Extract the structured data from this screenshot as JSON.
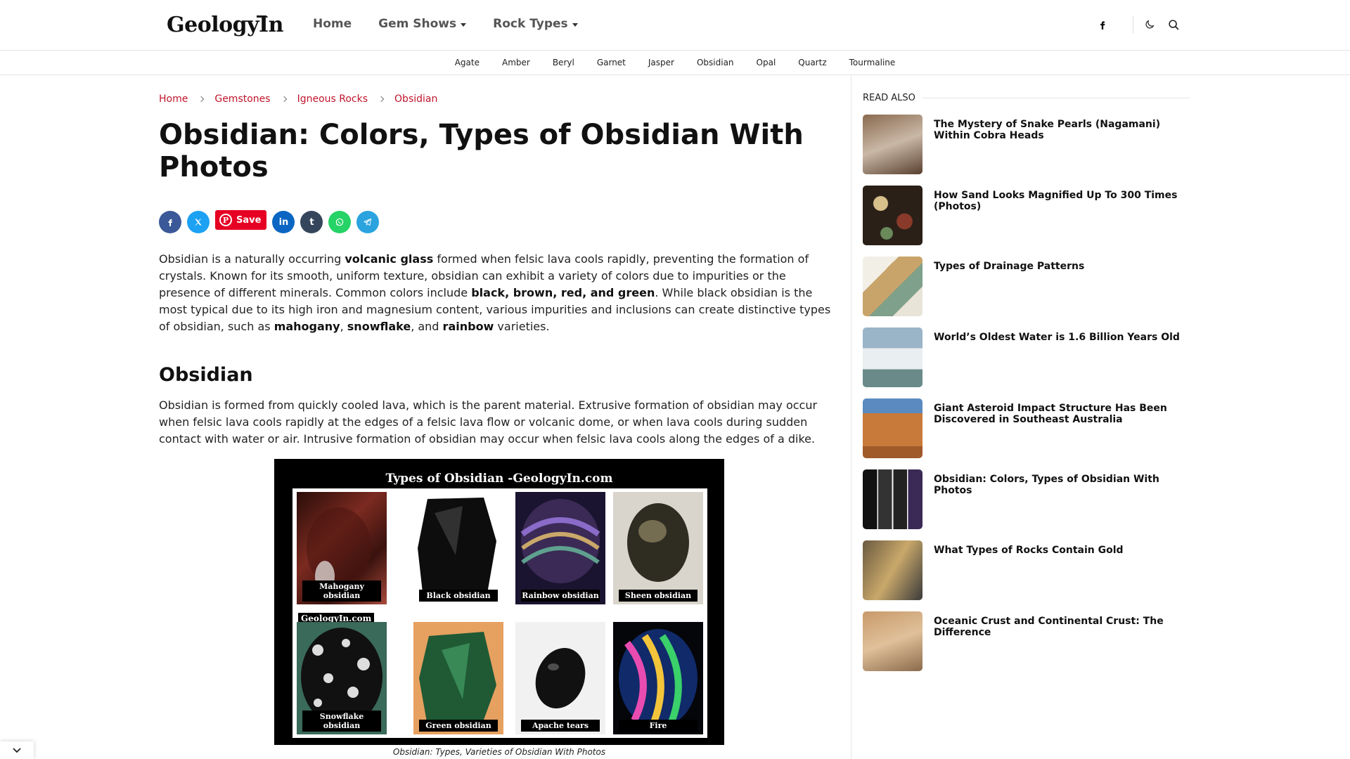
{
  "header": {
    "logo": "GeologyIn",
    "nav": [
      {
        "label": "Home",
        "dropdown": false
      },
      {
        "label": "Gem Shows",
        "dropdown": true
      },
      {
        "label": "Rock Types",
        "dropdown": true
      }
    ],
    "icons": [
      "facebook-icon",
      "dark-mode-icon",
      "search-icon"
    ]
  },
  "subnav": [
    "Agate",
    "Amber",
    "Beryl",
    "Garnet",
    "Jasper",
    "Obsidian",
    "Opal",
    "Quartz",
    "Tourmaline"
  ],
  "breadcrumb": [
    "Home",
    "Gemstones",
    "Igneous Rocks",
    "Obsidian"
  ],
  "article": {
    "title": "Obsidian: Colors, Types of Obsidian With Photos",
    "share": {
      "save_label": "Save",
      "networks": [
        "facebook",
        "x",
        "linkedin",
        "tumblr",
        "whatsapp",
        "telegram"
      ]
    },
    "intro": {
      "p1": "Obsidian is a naturally occurring ",
      "b1": "volcanic glass",
      "p2": " formed when felsic lava cools rapidly, preventing the formation of crystals. Known for its smooth, uniform texture, obsidian can exhibit a variety of colors due to impurities or the presence of different minerals. Common colors include ",
      "b2": "black, brown, red, and green",
      "p3": ". While black obsidian is the most typical due to its high iron and magnesium content, various impurities and inclusions can create distinctive types of obsidian, such as ",
      "b3": "mahogany",
      "p4": ", ",
      "b4": "snowflake",
      "p5": ", and ",
      "b5": "rainbow",
      "p6": " varieties."
    },
    "h2": "Obsidian",
    "p_formation": "Obsidian is formed from quickly cooled lava, which is the parent material. Extrusive formation of obsidian may occur when felsic lava cools rapidly at the edges of a felsic lava flow or volcanic dome, or when lava cools during sudden contact with water or air. Intrusive formation of obsidian may occur when felsic lava cools along the edges of a dike.",
    "figure": {
      "title": "Types of Obsidian -GeologyIn.com",
      "watermark": "GeologyIn.com",
      "tiles": [
        "Mahogany obsidian",
        "Black obsidian",
        "Rainbow obsidian",
        "Sheen obsidian",
        "Snowflake obsidian",
        "Green obsidian",
        "Apache tears",
        "Fire"
      ],
      "caption": "Obsidian: Types, Varieties of Obsidian With Photos"
    }
  },
  "sidebar": {
    "heading": "READ ALSO",
    "items": [
      "The Mystery of Snake Pearls (Nagamani) Within Cobra Heads",
      "How Sand Looks Magnified Up To 300 Times (Photos)",
      "Types of Drainage Patterns",
      "World’s Oldest Water is 1.6 Billion Years Old",
      "Giant Asteroid Impact Structure Has Been Discovered in Southeast Australia",
      "Obsidian: Colors, Types of Obsidian With Photos",
      "What Types of Rocks Contain Gold",
      "Oceanic Crust and Continental Crust: The Difference"
    ]
  },
  "colors": {
    "accent": "#c0152b",
    "facebook": "#3b5998",
    "x": "#1da1f2",
    "pinterest": "#e60023",
    "linkedin": "#0a66c2",
    "tumblr": "#35465c",
    "whatsapp": "#25d366",
    "telegram": "#2aa3df"
  }
}
